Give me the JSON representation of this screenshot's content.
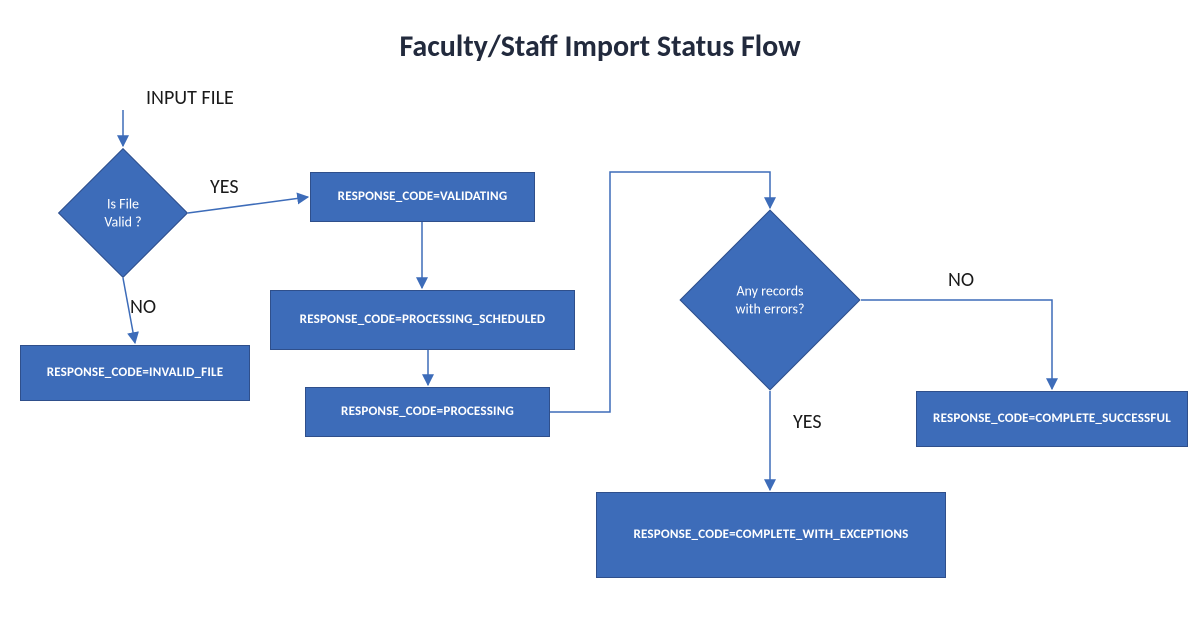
{
  "title": "Faculty/Staff Import Status Flow",
  "labels": {
    "input_file": "INPUT FILE",
    "yes1": "YES",
    "no1": "NO",
    "yes2": "YES",
    "no2": "NO"
  },
  "decisions": {
    "is_file_valid": "Is File\nValid ?",
    "any_errors": "Any records\nwith errors?"
  },
  "processes": {
    "invalid_file": "RESPONSE_CODE=INVALID_FILE",
    "validating": "RESPONSE_CODE=VALIDATING",
    "processing_scheduled": "RESPONSE_CODE=PROCESSING_SCHEDULED",
    "processing": "RESPONSE_CODE=PROCESSING",
    "complete_successful": "RESPONSE_CODE=COMPLETE_SUCCESSFUL",
    "complete_exceptions": "RESPONSE_CODE=COMPLETE_WITH_EXCEPTIONS"
  },
  "colors": {
    "shape_fill": "#3d6cb9",
    "shape_stroke": "#2f4f8b",
    "connector": "#3d6cb9",
    "title": "#222a3d"
  }
}
